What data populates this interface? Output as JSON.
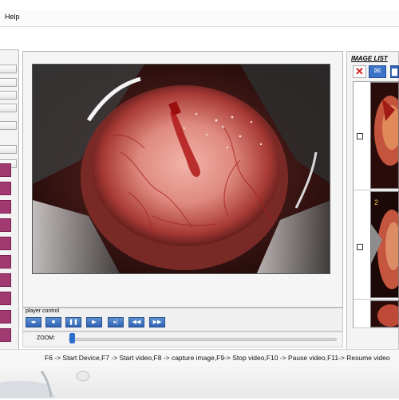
{
  "menu": {
    "help_label": "Help"
  },
  "player_control": {
    "label": "player control",
    "buttons": [
      {
        "name": "previous-button",
        "glyph": "◂▸"
      },
      {
        "name": "stop-button",
        "glyph": "■"
      },
      {
        "name": "pause-button",
        "glyph": "❚❚"
      },
      {
        "name": "play-button",
        "glyph": "▶"
      },
      {
        "name": "step-button",
        "glyph": "▸|"
      },
      {
        "name": "rewind-button",
        "glyph": "◀◀"
      },
      {
        "name": "fast-forward-button",
        "glyph": "▶▶"
      }
    ],
    "zoom_label": "ZOOM:",
    "zoom_value": 0
  },
  "image_list": {
    "title": "IMAGE LIST",
    "items": [
      {
        "checked": false
      },
      {
        "checked": false
      },
      {
        "checked": false
      }
    ]
  },
  "status": {
    "text": "F6 -> Start Device,F7 -> Start video,F8 -> capture image,F9-> Stop video,F10 -> Pause video,F11-> Resume video"
  },
  "colors": {
    "accent": "#2f63b3",
    "side_button": "#a23a72",
    "close": "#d01616"
  },
  "icons": [
    "close-icon",
    "mail-icon",
    "save-icon"
  ]
}
